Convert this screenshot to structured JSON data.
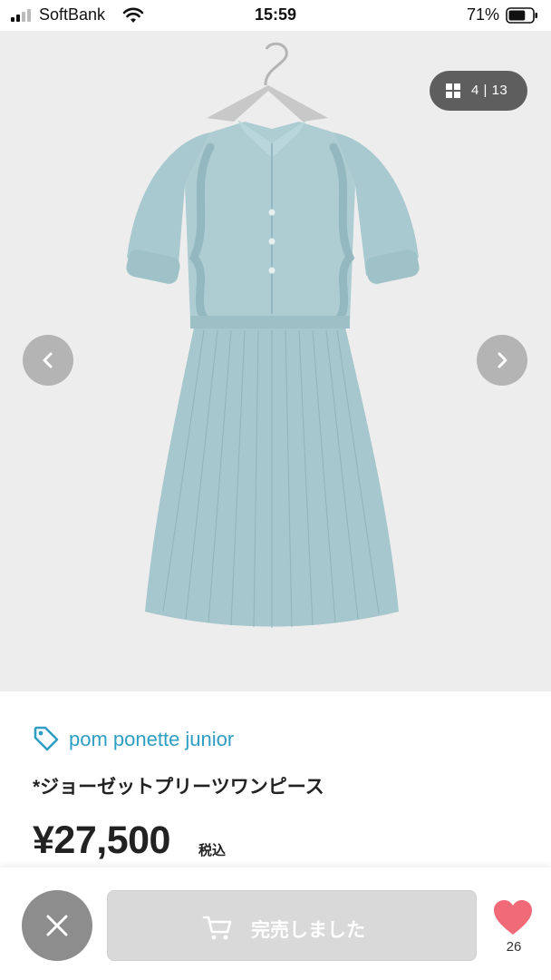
{
  "status_bar": {
    "carrier": "SoftBank",
    "time": "15:59",
    "battery": "71%",
    "battery_level": 0.71
  },
  "gallery": {
    "counter": "4 | 13",
    "current": 4,
    "total": 13
  },
  "product": {
    "brand": "pom ponette junior",
    "title": "*ジョーゼットプリーツワンピース",
    "price": "¥27,500",
    "tax_label": "税込"
  },
  "actions": {
    "sold_out_label": "完売しました",
    "like_count": "26"
  },
  "colors": {
    "brand_text": "#2f9ec3",
    "like_heart": "#f06a78",
    "sold_out_button": "#d9d9d9",
    "close_button": "#8d8d8d",
    "dress": "#a9cad0"
  }
}
